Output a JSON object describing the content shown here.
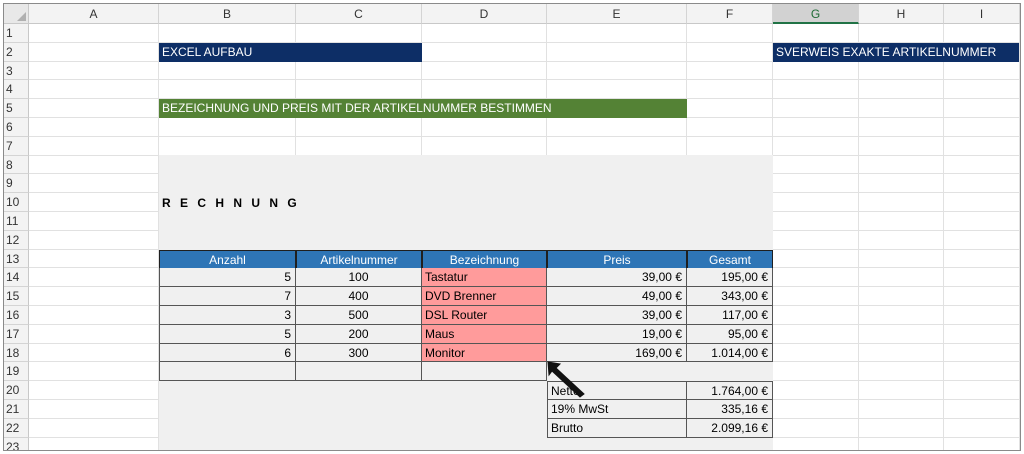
{
  "columns": [
    "A",
    "B",
    "C",
    "D",
    "E",
    "F",
    "G",
    "H",
    "I"
  ],
  "selected_column": "G",
  "rows": [
    "1",
    "2",
    "3",
    "4",
    "5",
    "6",
    "7",
    "8",
    "9",
    "10",
    "11",
    "12",
    "13",
    "14",
    "15",
    "16",
    "17",
    "18",
    "19",
    "20",
    "21",
    "22",
    "23"
  ],
  "banners": {
    "excel_aufbau": "EXCEL AUFBAU",
    "sverweis": "SVERWEIS EXAKTE ARTIKELNUMMER",
    "bezeichnung": "BEZEICHNUNG UND PREIS  MIT DER ARTIKELNUMMER BESTIMMEN"
  },
  "invoice": {
    "title": "R E C H N U N G",
    "headers": [
      "Anzahl",
      "Artikelnummer",
      "Bezeichnung",
      "Preis",
      "Gesamt"
    ],
    "rows": [
      {
        "anzahl": "5",
        "artikel": "100",
        "bezeichnung": "Tastatur",
        "preis": "39,00 €",
        "gesamt": "195,00 €"
      },
      {
        "anzahl": "7",
        "artikel": "400",
        "bezeichnung": "DVD Brenner",
        "preis": "49,00 €",
        "gesamt": "343,00 €"
      },
      {
        "anzahl": "3",
        "artikel": "500",
        "bezeichnung": "DSL Router",
        "preis": "39,00 €",
        "gesamt": "117,00 €"
      },
      {
        "anzahl": "5",
        "artikel": "200",
        "bezeichnung": "Maus",
        "preis": "19,00 €",
        "gesamt": "95,00 €"
      },
      {
        "anzahl": "6",
        "artikel": "300",
        "bezeichnung": "Monitor",
        "preis": "169,00 €",
        "gesamt": "1.014,00 €"
      }
    ],
    "summary": [
      {
        "label": "Netto",
        "value": "1.764,00 €"
      },
      {
        "label": "19% MwSt",
        "value": "335,16 €"
      },
      {
        "label": "Brutto",
        "value": "2.099,16 €"
      }
    ]
  },
  "colors": {
    "navy_banner": "#0d2e66",
    "green_banner": "#548235",
    "table_header": "#2e75b6",
    "highlight": "#ff9b9b"
  },
  "icons": {
    "cursor": "arrow-cursor-icon"
  }
}
